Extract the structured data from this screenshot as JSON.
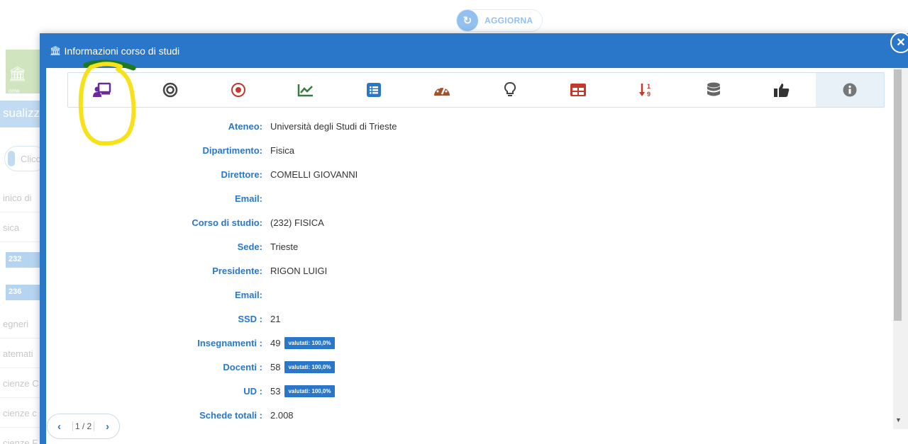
{
  "background": {
    "refresh_button": "AGGIORNA",
    "sidebar_green_label": "ome",
    "sidebar_blue_text": "sualizz",
    "sidebar_pill_text": "Clicc",
    "items": [
      "inico di",
      "sica",
      "egneri",
      "atemati",
      "cienze C",
      "cienze c",
      "cienze F"
    ],
    "chips": [
      "232",
      "236"
    ]
  },
  "modal": {
    "title": "Informazioni corso di studi",
    "toolbar": [
      {
        "name": "course-icon",
        "color": "#6a2a9c"
      },
      {
        "name": "target-rings-icon",
        "color": "#444444"
      },
      {
        "name": "target-dot-icon",
        "color": "#c0392b"
      },
      {
        "name": "chart-line-icon",
        "color": "#3a7a3a"
      },
      {
        "name": "list-icon",
        "color": "#2a77c9"
      },
      {
        "name": "dashboard-icon",
        "color": "#a0522d"
      },
      {
        "name": "lightbulb-icon",
        "color": "#444444"
      },
      {
        "name": "table-icon",
        "color": "#c0392b"
      },
      {
        "name": "sort-numeric-icon",
        "color": "#c0392b"
      },
      {
        "name": "database-icon",
        "color": "#666666"
      },
      {
        "name": "thumbs-up-icon",
        "color": "#333333"
      },
      {
        "name": "info-icon",
        "color": "#777777"
      }
    ],
    "fields": [
      {
        "label": "Ateneo:",
        "value": "Università degli Studi di Trieste"
      },
      {
        "label": "Dipartimento:",
        "value": "Fisica"
      },
      {
        "label": "Direttore:",
        "value": "COMELLI GIOVANNI"
      },
      {
        "label": "Email:",
        "value": ""
      },
      {
        "label": "Corso di studio:",
        "value": "(232) FISICA"
      },
      {
        "label": "Sede:",
        "value": "Trieste"
      },
      {
        "label": "Presidente:",
        "value": "RIGON LUIGI"
      },
      {
        "label": "Email:",
        "value": ""
      },
      {
        "label": "SSD :",
        "value": "21"
      },
      {
        "label": "Insegnamenti :",
        "value": "49",
        "badge": "valutati: 100,0%"
      },
      {
        "label": "Docenti :",
        "value": "58",
        "badge": "valutati: 100,0%"
      },
      {
        "label": "UD :",
        "value": "53",
        "badge": "valutati: 100,0%"
      },
      {
        "label": "Schede totali :",
        "value": "2.008"
      }
    ],
    "pager": {
      "text": "1 / 2"
    }
  },
  "colors": {
    "primary": "#2a77c9",
    "annotation_yellow": "#f7e21a",
    "annotation_green": "#1f7a1f"
  }
}
